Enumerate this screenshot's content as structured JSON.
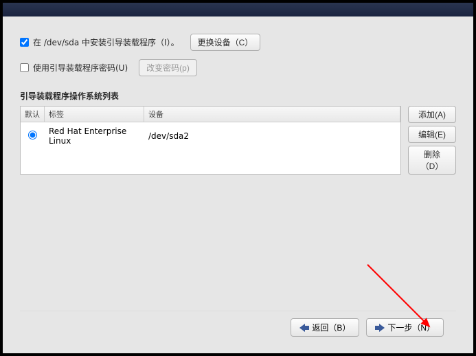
{
  "options": {
    "install_bootloader_label": "在 /dev/sda 中安装引导装载程序（I）。",
    "install_bootloader_checked": true,
    "change_device_btn": "更换设备（C）",
    "use_password_label": "使用引导装载程序密码(U)",
    "use_password_checked": false,
    "change_password_btn": "改变密码(p)"
  },
  "table": {
    "title": "引导装载程序操作系统列表",
    "headers": {
      "default": "默认",
      "label": "标签",
      "device": "设备"
    },
    "rows": [
      {
        "selected": true,
        "label": "Red Hat Enterprise Linux",
        "device": "/dev/sda2"
      }
    ]
  },
  "side_buttons": {
    "add": "添加(A)",
    "edit": "编辑(E)",
    "delete": "删除（D）"
  },
  "footer": {
    "back": "返回（B）",
    "next": "下一步（N）"
  }
}
